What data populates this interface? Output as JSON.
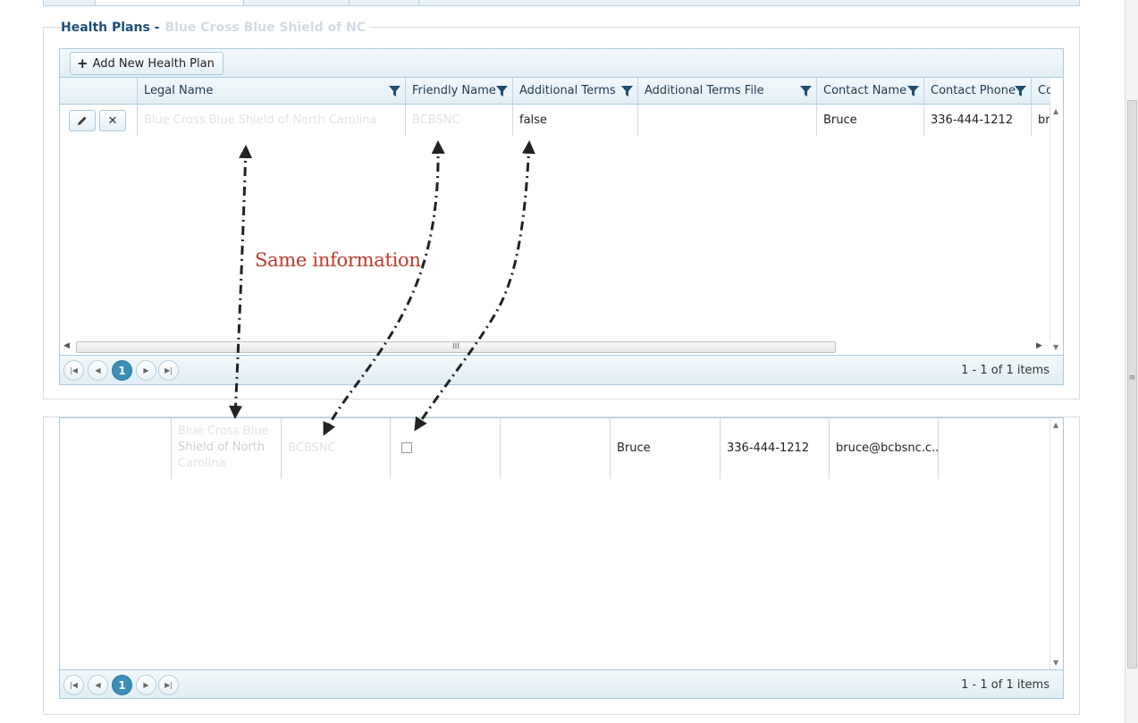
{
  "section": {
    "title": "Health Plans -",
    "title_blurred": "Blue Cross Blue Shield of NC"
  },
  "grid1": {
    "add_button_label": "Add New Health Plan",
    "columns": [
      "Legal Name",
      "Friendly Name",
      "Additional Terms",
      "Additional Terms File",
      "Contact Name",
      "Contact Phone",
      "Co"
    ],
    "row": {
      "legal_name": "Blue Cross Blue Shield of North Carolina",
      "friendly_name": "BCBSNC",
      "additional_terms": "false",
      "additional_terms_file": "",
      "contact_name": "Bruce",
      "contact_phone": "336-444-1212",
      "contact_email": "br"
    },
    "pager": {
      "current_page": "1",
      "info": "1 - 1 of 1 items"
    }
  },
  "grid2": {
    "row": {
      "legal_name_line1": "Blue Cross Blue",
      "legal_name_line2": "Shield of North",
      "legal_name_line3": "Carolina",
      "friendly_name": "BCBSNC",
      "contact_name": "Bruce",
      "contact_phone": "336-444-1212",
      "contact_email": "bruce@bcbsnc.c..."
    },
    "pager": {
      "current_page": "1",
      "info": "1 - 1 of 1 items"
    }
  },
  "annotation": {
    "text": "Same information",
    "color": "#c0392b"
  },
  "icons": [
    "plus-icon",
    "edit-icon",
    "delete-icon",
    "filter-icon",
    "first-page-icon",
    "prev-page-icon",
    "next-page-icon",
    "last-page-icon"
  ]
}
